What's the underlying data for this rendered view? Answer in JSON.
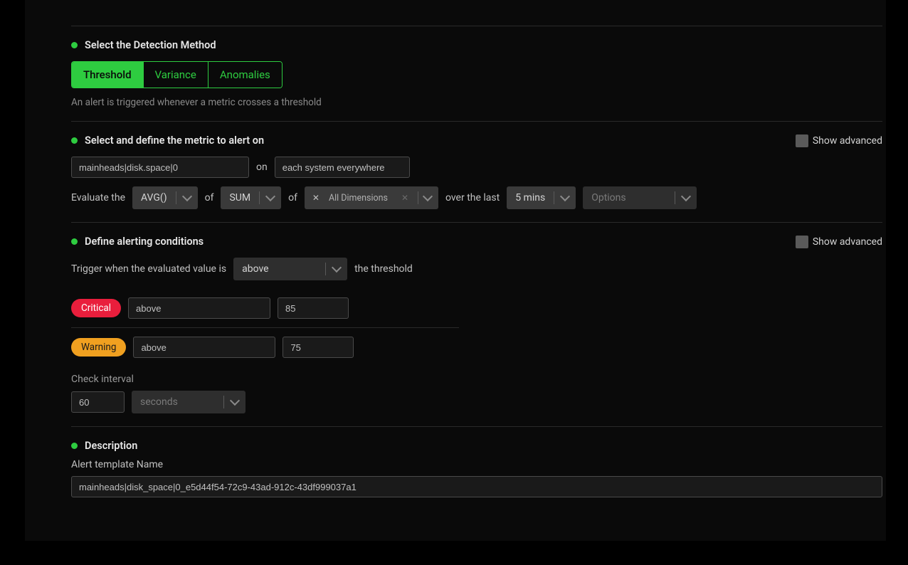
{
  "detection": {
    "title": "Select the Detection Method",
    "tabs": [
      "Threshold",
      "Variance",
      "Anomalies"
    ],
    "hint": "An alert is triggered whenever a metric crosses a threshold"
  },
  "metric": {
    "title": "Select and define the metric to alert on",
    "show_advanced": "Show advanced",
    "metric_value": "mainheads|disk.space|0",
    "on": "on",
    "scope_value": "each system everywhere",
    "evaluate": "Evaluate the",
    "agg1": "AVG()",
    "of1": "of",
    "agg2": "SUM",
    "of2": "of",
    "dims": "All Dimensions",
    "over": "over the last",
    "window": "5 mins",
    "options": "Options"
  },
  "conditions": {
    "title": "Define alerting conditions",
    "show_advanced": "Show advanced",
    "trigger_prefix": "Trigger when the evaluated value is",
    "direction": "above",
    "trigger_suffix": "the threshold",
    "critical_label": "Critical",
    "critical_op": "above",
    "critical_val": "85",
    "warning_label": "Warning",
    "warning_op": "above",
    "warning_val": "75",
    "interval_label": "Check interval",
    "interval_val": "60",
    "interval_unit": "seconds"
  },
  "description": {
    "title": "Description",
    "name_label": "Alert template Name",
    "name_value": "mainheads|disk_space|0_e5d44f54-72c9-43ad-912c-43df999037a1"
  }
}
